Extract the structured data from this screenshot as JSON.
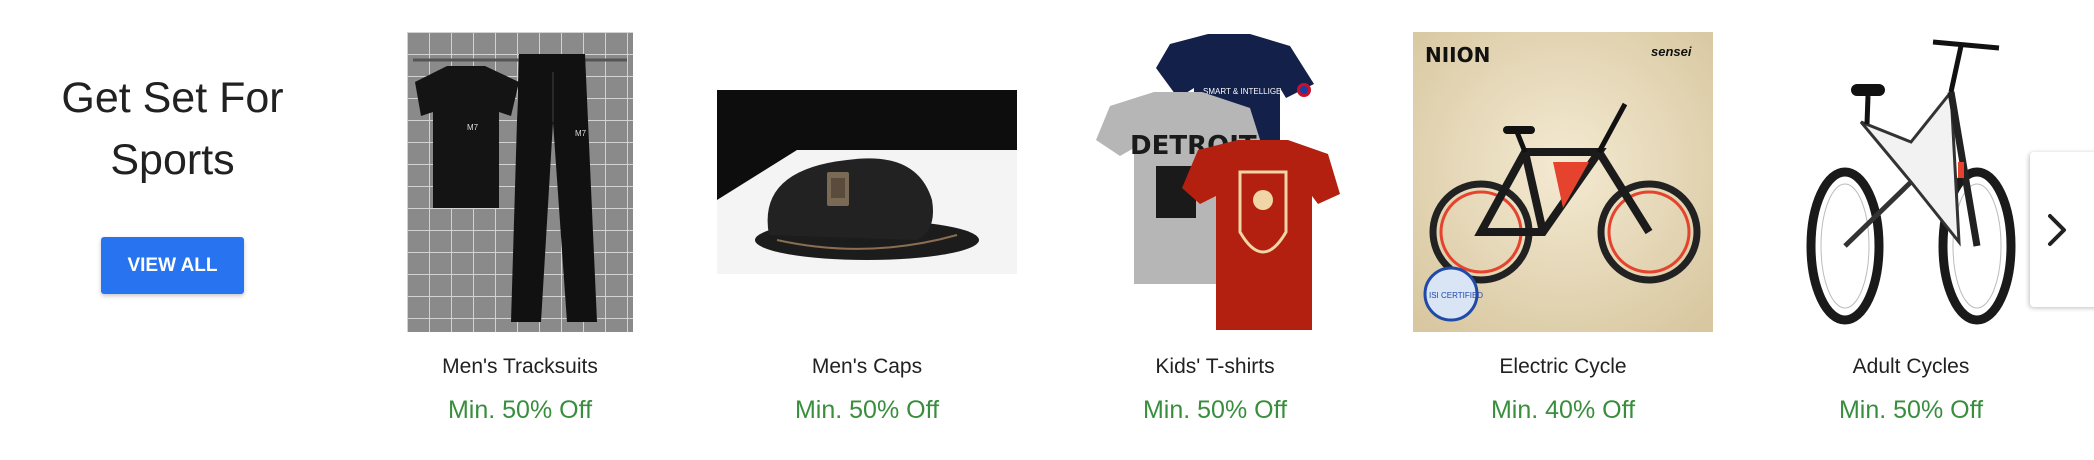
{
  "section": {
    "title": "Get Set For Sports",
    "view_all_label": "VIEW ALL",
    "accent_color": "#2874f0",
    "offer_color": "#388e3c"
  },
  "products": [
    {
      "name": "Men's Tracksuits",
      "offer": "Min. 50% Off"
    },
    {
      "name": "Men's Caps",
      "offer": "Min. 50% Off"
    },
    {
      "name": "Kids' T-shirts",
      "offer": "Min. 50% Off"
    },
    {
      "name": "Electric Cycle",
      "offer": "Min. 40% Off"
    },
    {
      "name": "Adult Cycles",
      "offer": "Min. 50% Off"
    }
  ],
  "image_text": {
    "tshirt_print": "SMART & INTELLIGE",
    "grey_tee": "DETROIT",
    "brand_left": "NIION",
    "brand_right": "sensei",
    "badge": "ISI CERTIFIED"
  },
  "icons": {
    "next": "chevron-right-icon"
  }
}
